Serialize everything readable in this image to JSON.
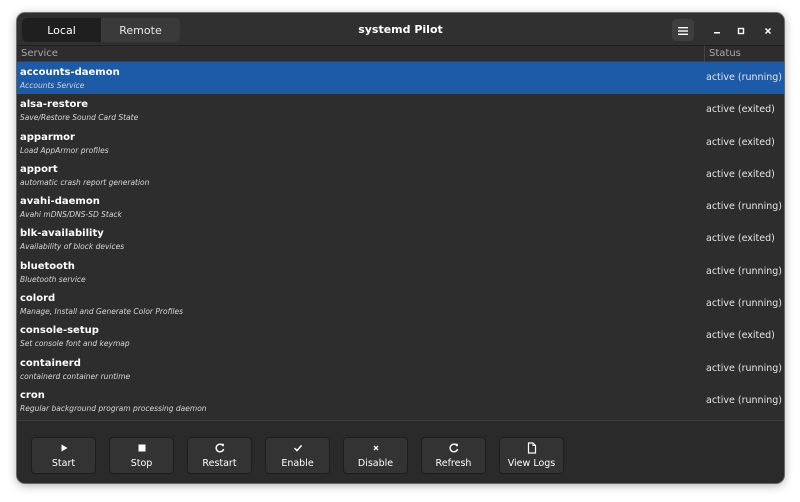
{
  "window": {
    "title": "systemd Pilot"
  },
  "switcher": {
    "local_label": "Local",
    "remote_label": "Remote",
    "active": "Local"
  },
  "list_header": {
    "service": "Service",
    "status": "Status"
  },
  "services": [
    {
      "name": "accounts-daemon",
      "description": "Accounts Service",
      "status": "active (running)",
      "selected": true
    },
    {
      "name": "alsa-restore",
      "description": "Save/Restore Sound Card State",
      "status": "active (exited)"
    },
    {
      "name": "apparmor",
      "description": "Load AppArmor profiles",
      "status": "active (exited)"
    },
    {
      "name": "apport",
      "description": "automatic crash report generation",
      "status": "active (exited)"
    },
    {
      "name": "avahi-daemon",
      "description": "Avahi mDNS/DNS-SD Stack",
      "status": "active (running)"
    },
    {
      "name": "blk-availability",
      "description": "Availability of block devices",
      "status": "active (exited)"
    },
    {
      "name": "bluetooth",
      "description": "Bluetooth service",
      "status": "active (running)"
    },
    {
      "name": "colord",
      "description": "Manage, Install and Generate Color Profiles",
      "status": "active (running)"
    },
    {
      "name": "console-setup",
      "description": "Set console font and keymap",
      "status": "active (exited)"
    },
    {
      "name": "containerd",
      "description": "containerd container runtime",
      "status": "active (running)"
    },
    {
      "name": "cron",
      "description": "Regular background program processing daemon",
      "status": "active (running)"
    }
  ],
  "toolbar": {
    "start": "Start",
    "stop": "Stop",
    "restart": "Restart",
    "enable": "Enable",
    "disable": "Disable",
    "refresh": "Refresh",
    "view_logs": "View Logs"
  },
  "colors": {
    "selection": "#1d5aa8",
    "window_bg": "#2d2d2d",
    "button_bg": "#333333"
  },
  "icons": {
    "menu": "hamburger-icon",
    "minimize": "minimize-icon",
    "maximize": "maximize-icon",
    "close": "close-icon",
    "start": "play-icon",
    "stop": "stop-icon",
    "restart": "restart-icon",
    "enable": "checkmark-icon",
    "disable": "x-icon",
    "refresh": "refresh-icon",
    "view_logs": "document-icon"
  }
}
